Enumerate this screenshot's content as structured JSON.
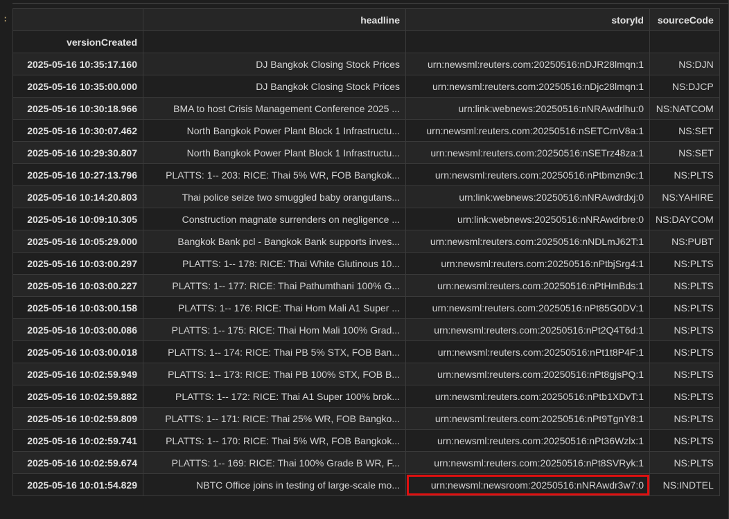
{
  "gutter": {
    "marker": ":"
  },
  "columns": {
    "index_name": "versionCreated",
    "headline": "headline",
    "storyId": "storyId",
    "sourceCode": "sourceCode"
  },
  "rows": [
    {
      "versionCreated": "2025-05-16 10:35:17.160",
      "headline": "DJ Bangkok Closing Stock Prices",
      "storyId": "urn:newsml:reuters.com:20250516:nDJR28lmqn:1",
      "sourceCode": "NS:DJN"
    },
    {
      "versionCreated": "2025-05-16 10:35:00.000",
      "headline": "DJ Bangkok Closing Stock Prices",
      "storyId": "urn:newsml:reuters.com:20250516:nDjc28lmqn:1",
      "sourceCode": "NS:DJCP"
    },
    {
      "versionCreated": "2025-05-16 10:30:18.966",
      "headline": "BMA to host Crisis Management Conference 2025 ...",
      "storyId": "urn:link:webnews:20250516:nNRAwdrlhu:0",
      "sourceCode": "NS:NATCOM"
    },
    {
      "versionCreated": "2025-05-16 10:30:07.462",
      "headline": "North Bangkok Power Plant Block 1 Infrastructu...",
      "storyId": "urn:newsml:reuters.com:20250516:nSETCrnV8a:1",
      "sourceCode": "NS:SET"
    },
    {
      "versionCreated": "2025-05-16 10:29:30.807",
      "headline": "North Bangkok Power Plant Block 1 Infrastructu...",
      "storyId": "urn:newsml:reuters.com:20250516:nSETrz48za:1",
      "sourceCode": "NS:SET"
    },
    {
      "versionCreated": "2025-05-16 10:27:13.796",
      "headline": "PLATTS: 1-- 203: RICE: Thai 5% WR, FOB Bangkok...",
      "storyId": "urn:newsml:reuters.com:20250516:nPtbmzn9c:1",
      "sourceCode": "NS:PLTS"
    },
    {
      "versionCreated": "2025-05-16 10:14:20.803",
      "headline": "Thai police seize two smuggled baby orangutans...",
      "storyId": "urn:link:webnews:20250516:nNRAwdrdxj:0",
      "sourceCode": "NS:YAHIRE"
    },
    {
      "versionCreated": "2025-05-16 10:09:10.305",
      "headline": "Construction magnate surrenders on negligence ...",
      "storyId": "urn:link:webnews:20250516:nNRAwdrbre:0",
      "sourceCode": "NS:DAYCOM"
    },
    {
      "versionCreated": "2025-05-16 10:05:29.000",
      "headline": "Bangkok Bank pcl - Bangkok Bank supports inves...",
      "storyId": "urn:newsml:reuters.com:20250516:nNDLmJ62T:1",
      "sourceCode": "NS:PUBT"
    },
    {
      "versionCreated": "2025-05-16 10:03:00.297",
      "headline": "PLATTS: 1-- 178: RICE: Thai White Glutinous 10...",
      "storyId": "urn:newsml:reuters.com:20250516:nPtbjSrg4:1",
      "sourceCode": "NS:PLTS"
    },
    {
      "versionCreated": "2025-05-16 10:03:00.227",
      "headline": "PLATTS: 1-- 177: RICE: Thai Pathumthani 100% G...",
      "storyId": "urn:newsml:reuters.com:20250516:nPtHmBds:1",
      "sourceCode": "NS:PLTS"
    },
    {
      "versionCreated": "2025-05-16 10:03:00.158",
      "headline": "PLATTS: 1-- 176: RICE: Thai Hom Mali A1 Super ...",
      "storyId": "urn:newsml:reuters.com:20250516:nPt85G0DV:1",
      "sourceCode": "NS:PLTS"
    },
    {
      "versionCreated": "2025-05-16 10:03:00.086",
      "headline": "PLATTS: 1-- 175: RICE: Thai Hom Mali 100% Grad...",
      "storyId": "urn:newsml:reuters.com:20250516:nPt2Q4T6d:1",
      "sourceCode": "NS:PLTS"
    },
    {
      "versionCreated": "2025-05-16 10:03:00.018",
      "headline": "PLATTS: 1-- 174: RICE: Thai PB 5% STX, FOB Ban...",
      "storyId": "urn:newsml:reuters.com:20250516:nPt1t8P4F:1",
      "sourceCode": "NS:PLTS"
    },
    {
      "versionCreated": "2025-05-16 10:02:59.949",
      "headline": "PLATTS: 1-- 173: RICE: Thai PB 100% STX, FOB B...",
      "storyId": "urn:newsml:reuters.com:20250516:nPt8gjsPQ:1",
      "sourceCode": "NS:PLTS"
    },
    {
      "versionCreated": "2025-05-16 10:02:59.882",
      "headline": "PLATTS: 1-- 172: RICE: Thai A1 Super 100% brok...",
      "storyId": "urn:newsml:reuters.com:20250516:nPtb1XDvT:1",
      "sourceCode": "NS:PLTS"
    },
    {
      "versionCreated": "2025-05-16 10:02:59.809",
      "headline": "PLATTS: 1-- 171: RICE: Thai 25% WR, FOB Bangko...",
      "storyId": "urn:newsml:reuters.com:20250516:nPt9TgnY8:1",
      "sourceCode": "NS:PLTS"
    },
    {
      "versionCreated": "2025-05-16 10:02:59.741",
      "headline": "PLATTS: 1-- 170: RICE: Thai 5% WR, FOB Bangkok...",
      "storyId": "urn:newsml:reuters.com:20250516:nPt36Wzlx:1",
      "sourceCode": "NS:PLTS"
    },
    {
      "versionCreated": "2025-05-16 10:02:59.674",
      "headline": "PLATTS: 1-- 169: RICE: Thai 100% Grade B WR, F...",
      "storyId": "urn:newsml:reuters.com:20250516:nPt8SVRyk:1",
      "sourceCode": "NS:PLTS"
    },
    {
      "versionCreated": "2025-05-16 10:01:54.829",
      "headline": "NBTC Office joins in testing of large-scale mo...",
      "storyId": "urn:newsml:newsroom:20250516:nNRAwdr3w7:0",
      "sourceCode": "NS:INDTEL",
      "highlight": "storyId"
    }
  ],
  "colors": {
    "background": "#1e1e1e",
    "highlight_border": "#e01010"
  }
}
